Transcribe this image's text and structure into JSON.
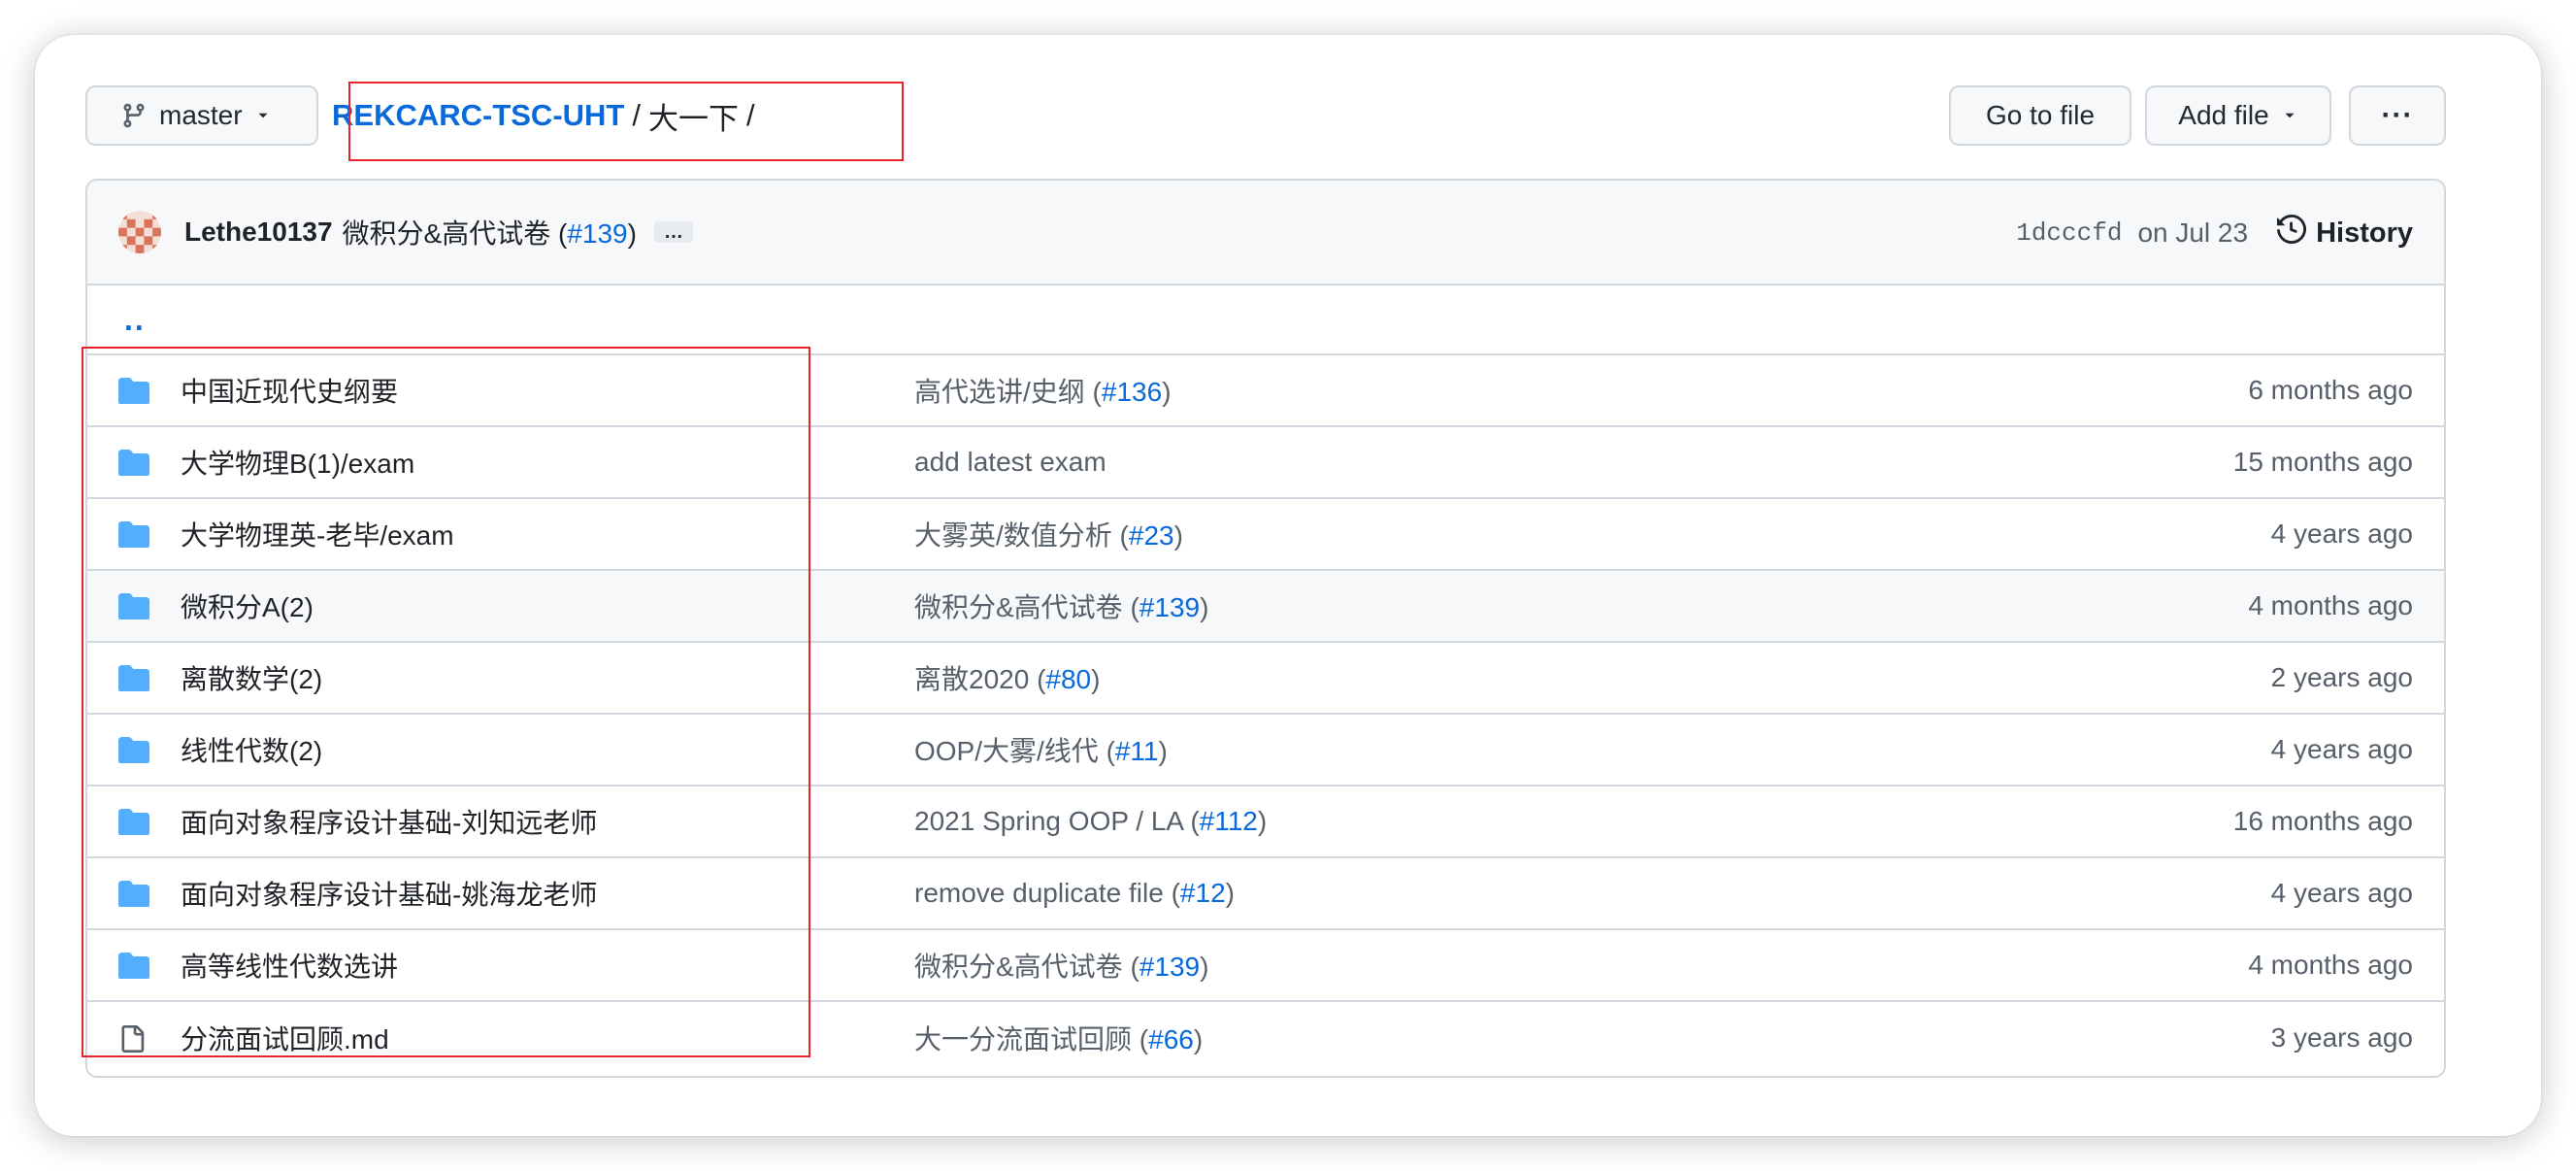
{
  "branch": {
    "name": "master"
  },
  "breadcrumb": {
    "repo": "REKCARC-TSC-UHT",
    "sep": "/",
    "dir": "大一下",
    "trail": "/"
  },
  "actions": {
    "goto_file": "Go to file",
    "add_file": "Add file",
    "more": "···"
  },
  "commit": {
    "author": "Lethe10137",
    "message": "微积分&高代试卷",
    "pr_open": " (",
    "pr": "#139",
    "pr_close": ")",
    "more": "…",
    "sha": "1dcccfd",
    "date": "on Jul 23",
    "history": "History"
  },
  "parent_link": "..",
  "files": [
    {
      "type": "dir",
      "name": "中国近现代史纲要",
      "msg": "高代选讲/史纲",
      "pr": "#136",
      "age": "6 months ago"
    },
    {
      "type": "dir",
      "name": "大学物理B(1)/exam",
      "msg": "add latest exam",
      "pr": "",
      "age": "15 months ago"
    },
    {
      "type": "dir",
      "name": "大学物理英-老毕/exam",
      "msg": "大雾英/数值分析",
      "pr": "#23",
      "age": "4 years ago"
    },
    {
      "type": "dir",
      "name": "微积分A(2)",
      "msg": "微积分&高代试卷",
      "pr": "#139",
      "age": "4 months ago"
    },
    {
      "type": "dir",
      "name": "离散数学(2)",
      "msg": "离散2020",
      "pr": "#80",
      "age": "2 years ago"
    },
    {
      "type": "dir",
      "name": "线性代数(2)",
      "msg": "OOP/大雾/线代",
      "pr": "#11",
      "age": "4 years ago"
    },
    {
      "type": "dir",
      "name": "面向对象程序设计基础-刘知远老师",
      "msg": "2021 Spring OOP / LA",
      "pr": "#112",
      "age": "16 months ago"
    },
    {
      "type": "dir",
      "name": "面向对象程序设计基础-姚海龙老师",
      "msg": "remove duplicate file",
      "pr": "#12",
      "age": "4 years ago"
    },
    {
      "type": "dir",
      "name": "高等线性代数选讲",
      "msg": "微积分&高代试卷",
      "pr": "#139",
      "age": "4 months ago"
    },
    {
      "type": "file",
      "name": "分流面试回顾.md",
      "msg": "大一分流面试回顾",
      "pr": "#66",
      "age": "3 years ago"
    }
  ],
  "colors": {
    "accent": "#0969da",
    "folder": "#54aeff",
    "annotation": "#e5242c"
  }
}
